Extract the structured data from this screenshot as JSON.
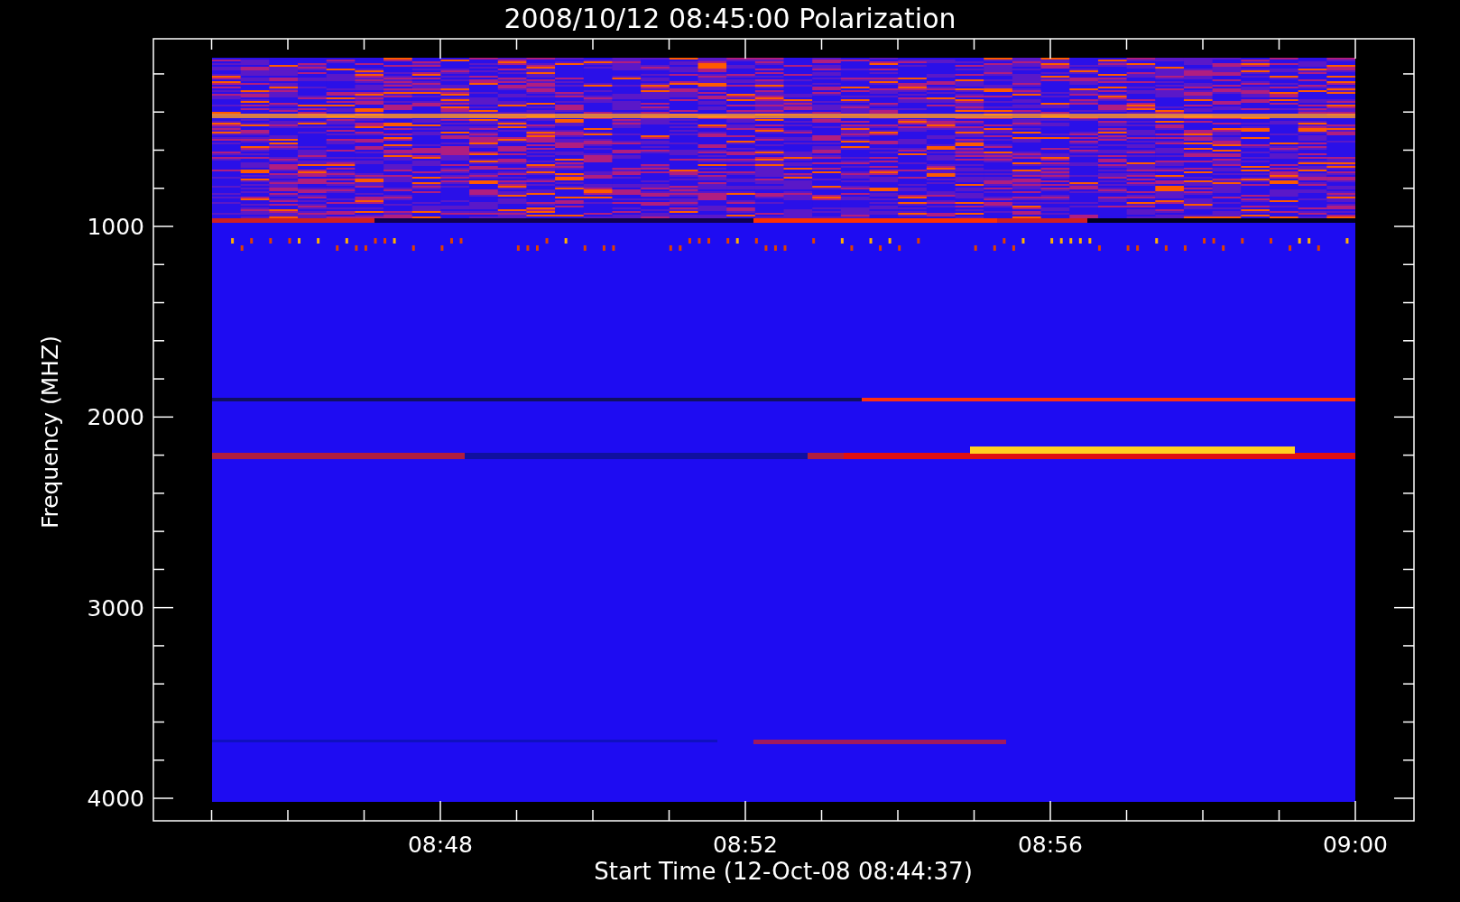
{
  "title": "2008/10/12 08:45:00 Polarization",
  "plot": {
    "ylabel": "Frequency (MHZ)",
    "xlabel": "Start Time (12-Oct-08 08:44:37)",
    "yticks": [
      "1000",
      "2000",
      "3000",
      "4000"
    ],
    "xticks": [
      "08:48",
      "08:52",
      "08:56",
      "09:00"
    ]
  }
}
